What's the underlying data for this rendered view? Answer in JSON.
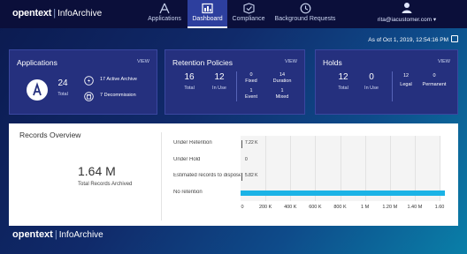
{
  "brand": {
    "logo": "opentext",
    "separator": "|",
    "app_name": "InfoArchive"
  },
  "nav": [
    {
      "label": "Applications",
      "icon": "applications-icon"
    },
    {
      "label": "Dashboard",
      "icon": "dashboard-icon",
      "active": true
    },
    {
      "label": "Compliance",
      "icon": "compliance-icon"
    },
    {
      "label": "Background Requests",
      "icon": "clock-icon"
    }
  ],
  "user": {
    "email": "rita@iacustomer.com",
    "caret": "▾"
  },
  "as_of": "As of Oct 1, 2019, 12:54:16 PM",
  "applications": {
    "title": "Applications",
    "view": "VIEW",
    "total_value": "24",
    "total_label": "Total",
    "active_value": "17",
    "active_label": "Active Archive",
    "decommission_value": "7",
    "decommission_label": "Decommission"
  },
  "retention": {
    "title": "Retention Policies",
    "view": "VIEW",
    "total_value": "16",
    "total_label": "Total",
    "inuse_value": "12",
    "inuse_label": "In Use",
    "fixed_value": "0",
    "fixed_label": "Fixed",
    "duration_value": "14",
    "duration_label": "Duration",
    "event_value": "1",
    "event_label": "Event",
    "mixed_value": "1",
    "mixed_label": "Mixed"
  },
  "holds": {
    "title": "Holds",
    "view": "VIEW",
    "total_value": "12",
    "total_label": "Total",
    "inuse_value": "0",
    "inuse_label": "In Use",
    "legal_value": "12",
    "legal_label": "Legal",
    "permanent_value": "0",
    "permanent_label": "Permanent"
  },
  "overview": {
    "title": "Records Overview",
    "total_value": "1.64 M",
    "total_label": "Total Records Archived"
  },
  "colors": {
    "bar": "#1bb3e6",
    "card": "#25307e",
    "topbar": "#0b0f3a"
  },
  "chart_data": {
    "type": "bar",
    "orientation": "horizontal",
    "categories": [
      "Under Retention",
      "Under Hold",
      "Estimated records to dispose",
      "No retention"
    ],
    "values": [
      7220,
      0,
      5820,
      1640000
    ],
    "value_labels": [
      "7.22 K",
      "0",
      "5.82 K",
      ""
    ],
    "xlim": [
      0,
      1600000
    ],
    "ticks": [
      0,
      200000,
      400000,
      600000,
      800000,
      1000000,
      1200000,
      1400000,
      1600000
    ],
    "tick_labels": [
      "0",
      "200 K",
      "400 K",
      "600 K",
      "800 K",
      "1 M",
      "1.20 M",
      "1.40 M",
      "1.60"
    ]
  },
  "footer": {
    "logo": "opentext",
    "separator": "|",
    "app_name": "InfoArchive"
  }
}
